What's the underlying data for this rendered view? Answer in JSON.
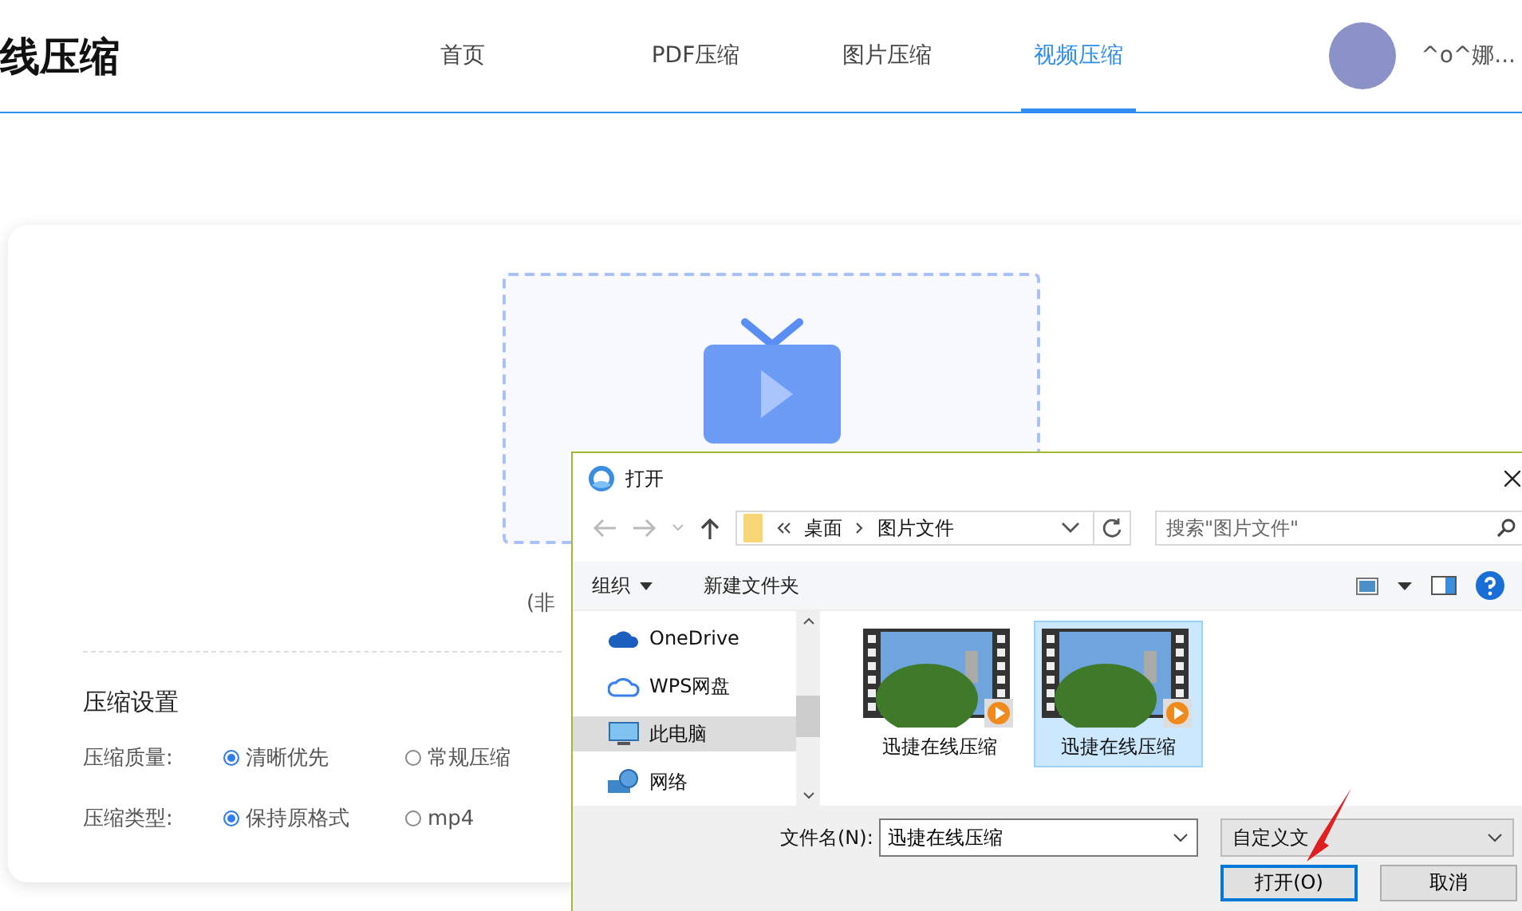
{
  "header": {
    "logo": "线压缩",
    "nav": [
      {
        "label": "首页",
        "selected": false
      },
      {
        "label": "PDF压缩",
        "selected": false
      },
      {
        "label": "图片压缩",
        "selected": false
      },
      {
        "label": "视频压缩",
        "selected": true
      }
    ],
    "username": "^o^娜..."
  },
  "upload": {
    "note": "(非"
  },
  "settings": {
    "title": "压缩设置",
    "rows": [
      {
        "label": "压缩质量:",
        "options": [
          {
            "label": "清晰优先",
            "selected": true
          },
          {
            "label": "常规压缩",
            "selected": false
          }
        ]
      },
      {
        "label": "压缩类型:",
        "options": [
          {
            "label": "保持原格式",
            "selected": true
          },
          {
            "label": "mp4",
            "selected": false
          }
        ]
      }
    ]
  },
  "dialog": {
    "title": "打开",
    "path": [
      "桌面",
      "图片文件"
    ],
    "search": {
      "placeholder": "搜索\"图片文件\""
    },
    "toolbar": [
      "组织",
      "新建文件夹"
    ],
    "sidebar": [
      {
        "label": "OneDrive",
        "kind": "onedrive",
        "selected": false
      },
      {
        "label": "WPS网盘",
        "kind": "cloud",
        "selected": false
      },
      {
        "label": "此电脑",
        "kind": "computer",
        "selected": true
      },
      {
        "label": "网络",
        "kind": "network",
        "selected": false
      }
    ],
    "files": [
      {
        "name": "迅捷在线压缩",
        "selected": false
      },
      {
        "name": "迅捷在线压缩",
        "selected": true
      }
    ],
    "filename_label": "文件名(N):",
    "filename": "迅捷在线压缩",
    "filter": "自定义文",
    "buttons": [
      "打开(O)",
      "取消"
    ]
  }
}
